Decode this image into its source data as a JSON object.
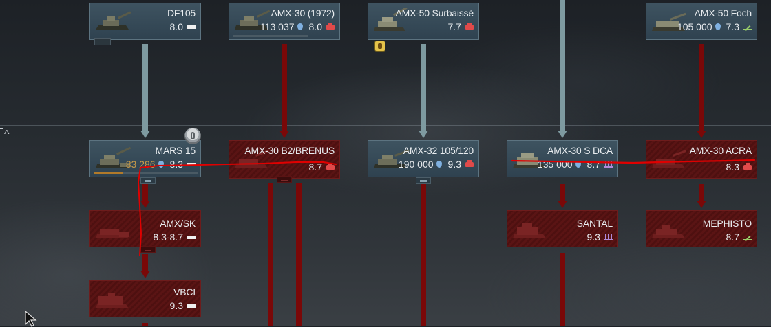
{
  "columns_top": [
    {
      "name": "DF105",
      "stats": "8.0",
      "class_icon": "medium-tank-icon",
      "rp": ""
    },
    {
      "name": "AMX-30 (1972)",
      "stats": "8.0",
      "class_icon": "heavy-tank-icon",
      "rp": "113 037"
    },
    {
      "name": "AMX-50 Surbaissé",
      "stats": "7.7",
      "class_icon": "heavy-tank-icon",
      "rp": ""
    },
    {
      "name": "AMX-50 Foch",
      "stats": "7.3",
      "class_icon": "tank-destroyer-icon",
      "rp": "105 000"
    }
  ],
  "rank_row": [
    {
      "name": "MARS 15",
      "br": "8.3",
      "rp": "83 286",
      "rp_total": "",
      "class_icon": "medium-tank-icon",
      "state": "researching",
      "progress": 0.28
    },
    {
      "name": "AMX-30 B2/BRENUS",
      "br": "8.7",
      "rp": "",
      "class_icon": "heavy-tank-icon",
      "state": "locked"
    },
    {
      "name": "AMX-32 105/120",
      "br": "9.3",
      "rp": "190 000",
      "class_icon": "heavy-tank-icon",
      "state": "researched"
    },
    {
      "name": "AMX-30 S DCA",
      "br": "8.7",
      "rp": "135 000",
      "class_icon": "spaa-icon",
      "state": "researched"
    },
    {
      "name": "AMX-30 ACRA",
      "br": "8.3",
      "rp": "",
      "class_icon": "heavy-tank-icon",
      "state": "locked"
    }
  ],
  "lower_rows": [
    {
      "name": "AMX/SK",
      "br": "8.3-8.7",
      "class_icon": "medium-tank-icon"
    },
    {
      "name": "SANTAL",
      "br": "9.3",
      "class_icon": "spaa-icon"
    },
    {
      "name": "MEPHISTO",
      "br": "8.7",
      "class_icon": "tank-destroyer-icon"
    },
    {
      "name": "VBCI",
      "br": "9.3",
      "class_icon": "medium-tank-icon"
    }
  ],
  "colors": {
    "researched": "#3e5360",
    "locked": "#5a1414",
    "link_researched": "#7e9aa0",
    "link_locked": "#7a0808",
    "annotation": "#e00000"
  }
}
